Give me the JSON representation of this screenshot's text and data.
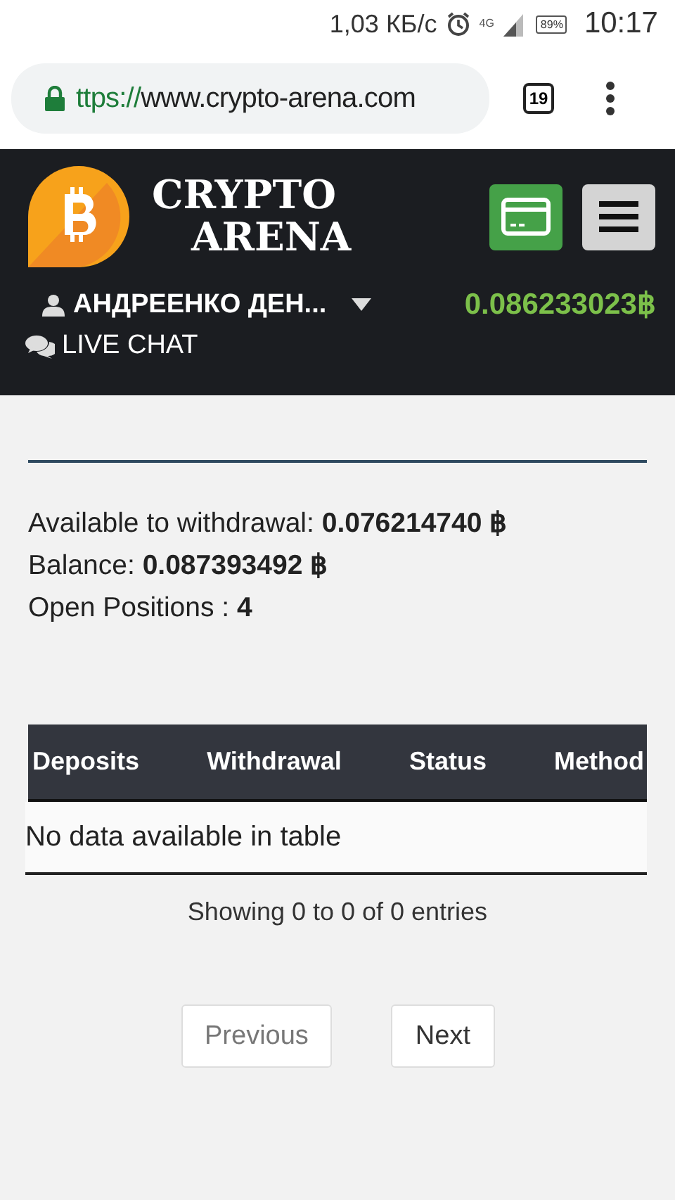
{
  "status_bar": {
    "speed": "1,03 КБ/с",
    "network": "4G",
    "battery": "89%",
    "time": "10:17"
  },
  "browser": {
    "url_scheme": "ttps://",
    "url_host": "www.crypto-arena.com",
    "secure": true,
    "tab_count": "19"
  },
  "header": {
    "logo_line1": "CRYPTO",
    "logo_line2": "ARENA",
    "user": "АНДРЕЕНКО ДЕН...",
    "balance": "0.086233023฿",
    "live_chat": "LIVE CHAT"
  },
  "summary": [
    "Available to withdrawal: **0.076214740 ฿**",
    "Balance: **0.087393492 ฿**",
    "Open Positions : **4**"
  ],
  "table": {
    "columns": [
      "Deposits",
      "Withdrawal",
      "Status",
      "Method"
    ],
    "empty_message": "No data available in table",
    "info": "Showing 0 to 0 of 0 entries"
  },
  "pager": [
    {
      "label": "Previous",
      "disabled": true
    },
    {
      "label": "Next",
      "disabled": false
    }
  ]
}
